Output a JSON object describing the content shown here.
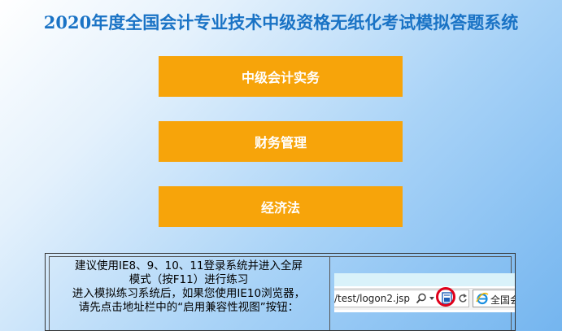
{
  "header": {
    "title": "2020年度全国会计专业技术中级资格无纸化考试模拟答题系统"
  },
  "subjects": [
    {
      "label": "中级会计实务"
    },
    {
      "label": "财务管理"
    },
    {
      "label": "经济法"
    }
  ],
  "notice": {
    "lines": [
      "建议使用IE8、9、10、11登录系统并进入全屏",
      "模式（按F11）进行练习",
      "进入模拟练习系统后，如果您使用IE10浏览器，",
      "请先点击地址栏中的“启用兼容性视图”按钮："
    ]
  },
  "browser_example": {
    "url_text": "/test/logon2.jsp",
    "tab_text": "全国会"
  },
  "colors": {
    "title": "#1a73c5",
    "button": "#f7a40a",
    "highlight_ring": "#e0001a"
  }
}
